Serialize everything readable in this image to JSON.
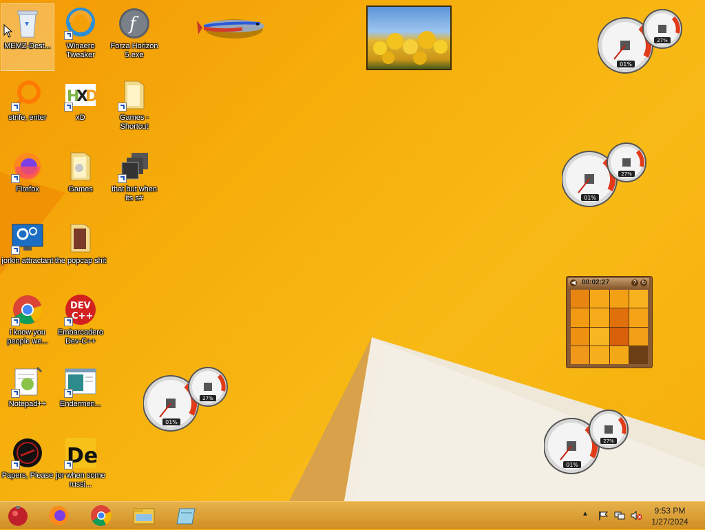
{
  "desktop_icons": [
    {
      "label": "MEMZ-Dest...",
      "icon": "recycle-bin-icon"
    },
    {
      "label": "Winaero Tweaker",
      "icon": "winaero-icon"
    },
    {
      "label": "Forza Horizon 5.exe",
      "icon": "flash-icon"
    },
    {
      "label": "strife, enter",
      "icon": "magnifier-icon"
    },
    {
      "label": "xD",
      "icon": "hxd-icon"
    },
    {
      "label": "Games - Shortcut",
      "icon": "folder-icon"
    },
    {
      "label": "Firefox",
      "icon": "firefox-icon"
    },
    {
      "label": "Games",
      "icon": "folder-icon"
    },
    {
      "label": "that but when its s#",
      "icon": "stack-icon"
    },
    {
      "label": "jorkin attractant",
      "icon": "settings-monitor-icon"
    },
    {
      "label": "the popcap shit",
      "icon": "folder-icon"
    },
    {
      "label": "i know you people we...",
      "icon": "chrome-icon"
    },
    {
      "label": "Embarcadero Dev-C++",
      "icon": "devcpp-icon"
    },
    {
      "label": "Notepad++",
      "icon": "notepad-icon"
    },
    {
      "label": "Endermen...",
      "icon": "window-icon"
    },
    {
      "label": "Papers, Please",
      "icon": "papers-icon"
    },
    {
      "label": "jor when some russi...",
      "icon": "de-icon"
    }
  ],
  "gadgets": {
    "cpu_meter": {
      "cpu": "01%",
      "memory": "27%"
    },
    "puzzle": {
      "timer": "00:02:27"
    }
  },
  "taskbar": {
    "clock_time": "9:53 PM",
    "clock_date": "1/27/2024"
  },
  "colors": {
    "wallpaper": "#f6ae0b",
    "taskbar": "#d99a2c"
  }
}
